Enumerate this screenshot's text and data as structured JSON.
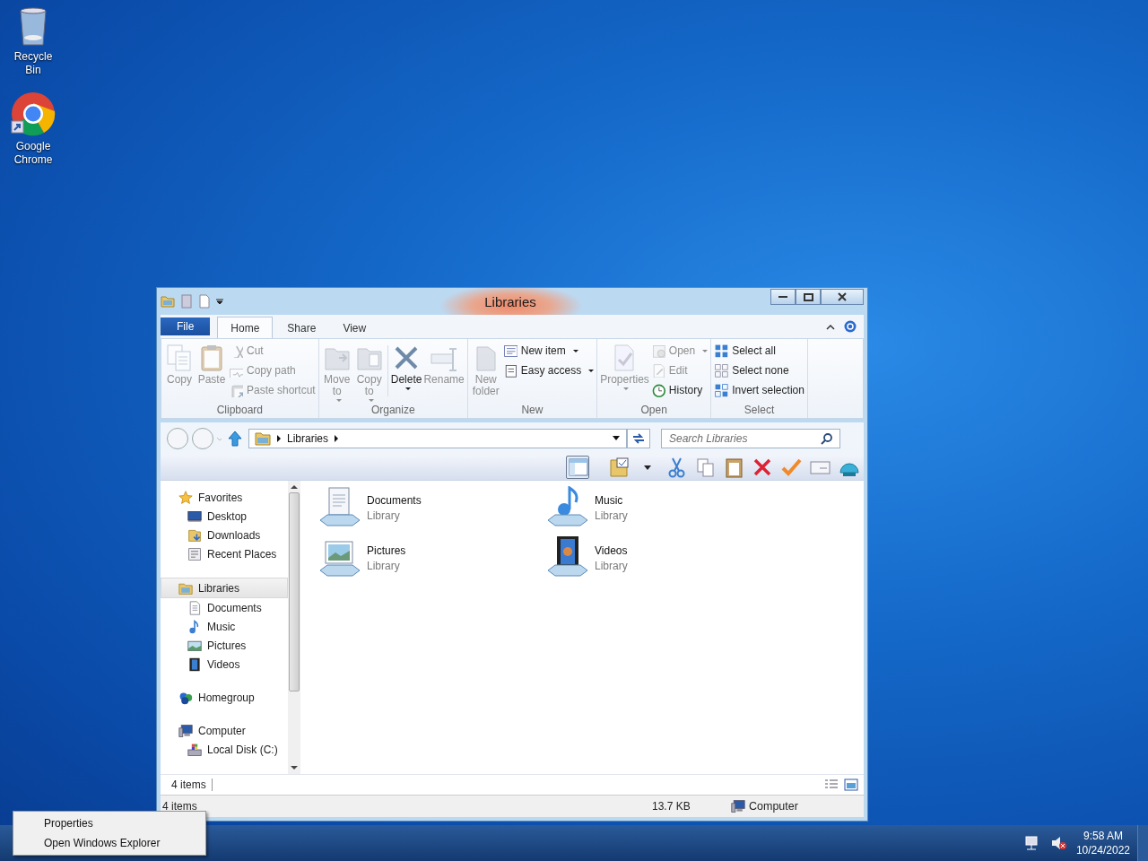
{
  "desktop_icons": [
    {
      "label": "Recycle Bin"
    },
    {
      "label": "Google Chrome"
    }
  ],
  "window": {
    "title": "Libraries",
    "tabs": [
      {
        "label": "File",
        "kind": "file",
        "selected": false
      },
      {
        "label": "Home",
        "kind": "tab",
        "selected": true
      },
      {
        "label": "Share",
        "kind": "tab",
        "selected": false
      },
      {
        "label": "View",
        "kind": "tab",
        "selected": false
      }
    ],
    "ribbon": {
      "groups": [
        {
          "label": "Clipboard",
          "items": [
            {
              "label": "Copy",
              "kind": "large",
              "disabled": true,
              "dropdown": false
            },
            {
              "label": "Paste",
              "kind": "large",
              "disabled": true,
              "dropdown": false
            },
            {
              "label": "Cut",
              "kind": "small",
              "disabled": true,
              "dropdown": false
            },
            {
              "label": "Copy path",
              "kind": "small",
              "disabled": true,
              "dropdown": false
            },
            {
              "label": "Paste shortcut",
              "kind": "small",
              "disabled": true,
              "dropdown": false
            }
          ]
        },
        {
          "label": "Organize",
          "items": [
            {
              "label": "Move to",
              "kind": "large",
              "disabled": true,
              "dropdown": true
            },
            {
              "label": "Copy to",
              "kind": "large",
              "disabled": true,
              "dropdown": true
            },
            {
              "label": "Delete",
              "kind": "large",
              "disabled": false,
              "dropdown": true
            },
            {
              "label": "Rename",
              "kind": "large",
              "disabled": true,
              "dropdown": false
            }
          ]
        },
        {
          "label": "New",
          "items": [
            {
              "label": "New folder",
              "kind": "large",
              "disabled": true,
              "dropdown": false
            },
            {
              "label": "New item",
              "kind": "small",
              "disabled": false,
              "dropdown": true
            },
            {
              "label": "Easy access",
              "kind": "small",
              "disabled": false,
              "dropdown": true
            }
          ]
        },
        {
          "label": "Open",
          "items": [
            {
              "label": "Properties",
              "kind": "large",
              "disabled": true,
              "dropdown": true
            },
            {
              "label": "Open",
              "kind": "small",
              "disabled": true,
              "dropdown": true
            },
            {
              "label": "Edit",
              "kind": "small",
              "disabled": true,
              "dropdown": false
            },
            {
              "label": "History",
              "kind": "small",
              "disabled": false,
              "dropdown": false
            }
          ]
        },
        {
          "label": "Select",
          "items": [
            {
              "label": "Select all",
              "kind": "small",
              "disabled": false,
              "dropdown": false
            },
            {
              "label": "Select none",
              "kind": "small",
              "disabled": false,
              "dropdown": false
            },
            {
              "label": "Invert selection",
              "kind": "small",
              "disabled": false,
              "dropdown": false
            }
          ]
        }
      ]
    },
    "address": {
      "path": [
        "Libraries"
      ],
      "search": {
        "placeholder": "Search Libraries"
      }
    },
    "nav_pane": {
      "sections": [
        {
          "label": "Favorites",
          "selected": false,
          "children": [
            {
              "label": "Desktop",
              "selected": false
            },
            {
              "label": "Downloads",
              "selected": false
            },
            {
              "label": "Recent Places",
              "selected": false
            }
          ]
        },
        {
          "label": "Libraries",
          "selected": true,
          "children": [
            {
              "label": "Documents",
              "selected": false
            },
            {
              "label": "Music",
              "selected": false
            },
            {
              "label": "Pictures",
              "selected": false
            },
            {
              "label": "Videos",
              "selected": false
            }
          ]
        },
        {
          "label": "Homegroup",
          "selected": false
        },
        {
          "label": "Computer",
          "selected": false,
          "children": [
            {
              "label": "Local Disk (C:)",
              "selected": false
            }
          ]
        }
      ]
    },
    "items": [
      {
        "name": "Documents",
        "type": "Library"
      },
      {
        "name": "Music",
        "type": "Library"
      },
      {
        "name": "Pictures",
        "type": "Library"
      },
      {
        "name": "Videos",
        "type": "Library"
      }
    ],
    "details_bar": {
      "count": "4 items"
    },
    "status_bar": {
      "count": "4 items",
      "size": "13.7 KB",
      "location": "Computer"
    }
  },
  "context_menu": {
    "items": [
      {
        "label": "Properties"
      },
      {
        "label": "Open Windows Explorer"
      }
    ]
  },
  "tray": {
    "time": "9:58 AM",
    "date": "10/24/2022"
  }
}
